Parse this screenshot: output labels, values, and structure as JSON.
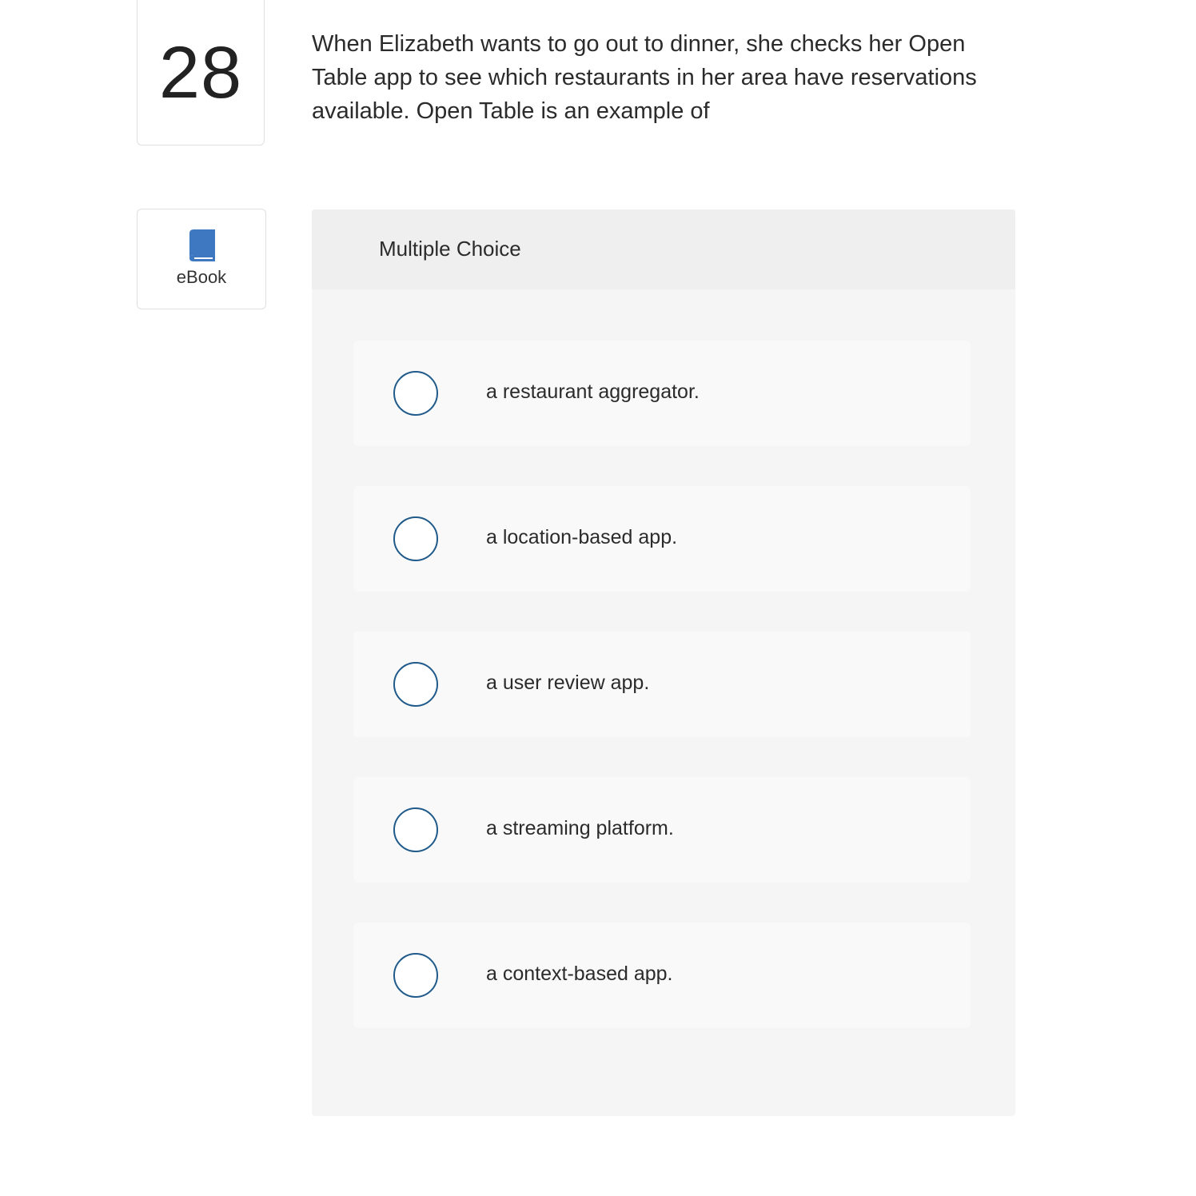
{
  "question": {
    "number": "28",
    "text": "When Elizabeth wants to go out to dinner, she checks her Open Table app to see which restaurants in her area have reservations available. Open Table is an example of"
  },
  "ebook": {
    "label": "eBook",
    "icon": "book-icon",
    "icon_color": "#3d78c0"
  },
  "multiple_choice": {
    "title": "Multiple Choice",
    "radio_color": "#1f5a8a",
    "options": [
      {
        "label": "a restaurant aggregator."
      },
      {
        "label": "a location-based app."
      },
      {
        "label": "a user review app."
      },
      {
        "label": "a streaming platform."
      },
      {
        "label": "a context-based app."
      }
    ]
  }
}
